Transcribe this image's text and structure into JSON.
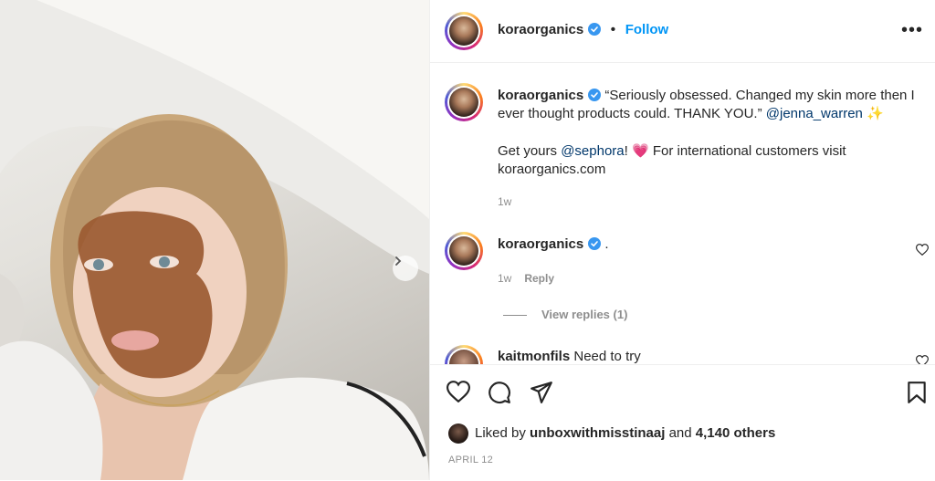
{
  "header": {
    "username": "koraorganics",
    "separator": "•",
    "follow_label": "Follow",
    "more_icon": "more-options-icon"
  },
  "caption": {
    "username": "koraorganics",
    "text_1": "“Seriously obsessed. Changed my skin more then I ever thought products could. THANK YOU.”",
    "mention_1": "@jenna_warren",
    "emoji_1": "✨",
    "text_2_prefix": "Get yours",
    "mention_2": "@sephora",
    "text_2_mid": "!",
    "emoji_2": "💗",
    "text_2_suffix": "For international customers visit koraorganics.com",
    "time": "1w"
  },
  "comments": [
    {
      "username": "koraorganics",
      "text": ".",
      "time": "1w",
      "reply_label": "Reply",
      "view_replies_label": "View replies (1)"
    },
    {
      "username": "kaitmonfils",
      "text": "Need to try"
    }
  ],
  "actions": {
    "like_icon": "heart-icon",
    "comment_icon": "comment-icon",
    "share_icon": "share-icon",
    "save_icon": "bookmark-icon"
  },
  "likes": {
    "prefix": "Liked by",
    "user": "unboxwithmisstinaaj",
    "and": "and",
    "others": "4,140 others"
  },
  "date": "APRIL 12",
  "colors": {
    "follow": "#0095f6",
    "verified": "#3897f0",
    "mention": "#00376b",
    "muted": "#8e8e8e"
  }
}
